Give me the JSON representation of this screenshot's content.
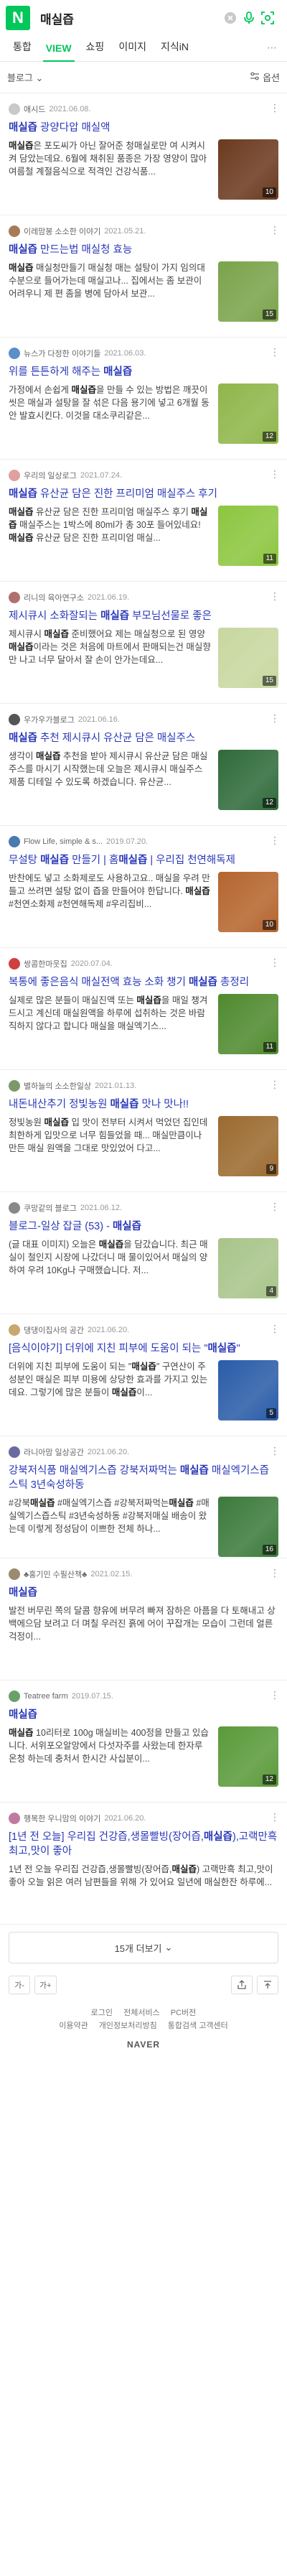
{
  "header": {
    "logo": "N",
    "query": "매실즙"
  },
  "tabs": [
    {
      "label": "통합"
    },
    {
      "label": "VIEW"
    },
    {
      "label": "쇼핑"
    },
    {
      "label": "이미지"
    },
    {
      "label": "지식iN"
    }
  ],
  "tab_more": "⋯",
  "filter": {
    "scope": "블로그",
    "option_label": "옵션"
  },
  "results": [
    {
      "author": "애시드",
      "date": "2021.06.08.",
      "title": "매실즙 광양다압 매실액",
      "desc": "매실즙은 포도씨가 아닌 잘어준 청매실로만 여 시켜시켜 담았는데요. 6월에 채취된 품종은 가장 영양이 많아 여름철 계절음식으로 적격인 건강식품...",
      "count": "10",
      "avatar": "#c9c9c9",
      "thumb": "#6b3a1f"
    },
    {
      "author": "이레맘봉 소소한 이야기",
      "date": "2021.05.21.",
      "title": "매실즙 만드는법 매실청 효능",
      "desc": "매실즙 매실청만들기 매실청 매는 설탕이 가지 임의대 수분으로 들어가는데 매실고나... 집에서는 좀 보관이 어려우니 제 편 좀을 병에 담아서 보관...",
      "count": "15",
      "avatar": "#a77a5a",
      "thumb": "#7aa34a"
    },
    {
      "author": "뉴스가 다정한 이야기들",
      "date": "2021.06.03.",
      "title": "위를 튼튼하게 해주는 매실즙",
      "desc": "가정에서 손쉽게 매실즙을 만들 수 있는 방법은 깨끗이 씻은 매실과 설탕을 잘 섞은 다음 용기에 넣고 6개월 동안 발효시킨다. 이것을 대소쿠리같은...",
      "count": "12",
      "avatar": "#5b8fc9",
      "thumb": "#8fb64a"
    },
    {
      "author": "우리의 일상로그",
      "date": "2021.07.24.",
      "title": "매실즙 유산균 담은 진한 프리미엄 매실주스 후기",
      "desc": "매실즙 유산균 담은 진한 프리미엄 매실주스 후기 매실즙 매실주스는 1박스에 80ml가 총 30포 들어있네요! 매실즙 유산균 담은 진한 프리미엄 매실...",
      "count": "11",
      "avatar": "#e0a0a0",
      "thumb": "#8cc63f"
    },
    {
      "author": "리니의 육아연구소",
      "date": "2021.06.19.",
      "title": "제시큐시 소화잘되는 매실즙 부모님선물로 좋은",
      "desc": "제시큐시 매실즙 준비했어요 제는 매실청으로 된 영양 매실즙이라는 것은 처음에 마트에서 판매되는건 매실향만 나고 너무 달아서 잘 손이 안가는데요...",
      "count": "15",
      "avatar": "#b07070",
      "thumb": "#c8d7a0"
    },
    {
      "author": "우가우가블로그",
      "date": "2021.06.16.",
      "title": "매실즙 추천 제시큐시 유산균 담은 매실주스",
      "desc": "생각이 매실즙 추천을 받아 제시큐시 유산균 담은 매실주스를 마시기 시작했는데 오늘은 제시큐시 매실주스 제품 디테일 수 있도록 하겠습니다. 유산균...",
      "count": "12",
      "avatar": "#555555",
      "thumb": "#2f6a3a"
    },
    {
      "author": "Flow Life, simple & s...",
      "date": "2019.07.20.",
      "title": "무설탕 매실즙 만들기 | 홈매실즙 | 우리집 천연해독제",
      "desc": "반찬에도 넣고 소화제로도 사용하고요.. 매실을 우려 만들고 쓰려면 설탕 없이 즙을 만들어야 한답니다. 매실즙 #천연소화제 #천연해독제 #우리집비...",
      "count": "10",
      "avatar": "#4a7ab0",
      "thumb": "#b5652e"
    },
    {
      "author": "쌍콤한마웃집",
      "date": "2020.07.04.",
      "title": "복통에 좋은음식 매실전액 효능 소화 챙기 매실즙 총정리",
      "desc": "실제로 많은 분들이 매실진액 또는 매실즙을 매일 챙겨드시고 계신데 매실원액을 하루에 섭취하는 것은 바람직하지 않다고 합니다 매실을 매실엑기스...",
      "count": "11",
      "avatar": "#d04040",
      "thumb": "#4f8a2e"
    },
    {
      "author": "별하늘의 소소한일상",
      "date": "2021.01.13.",
      "title": "내돈내산추기 정빛농원 매실즙 맛나 맛나!!",
      "desc": "정빛농원 매실즙 입 맛이 전부터 시켜서 먹었던 집인데 최한하게 입맛으로 너무 힘들었을 때... 매실만큼이나 만든 매실 원액을 그대로 맛있었어 다고...",
      "count": "9",
      "avatar": "#7a9a6a",
      "thumb": "#9b6a2f"
    },
    {
      "author": "쿠망같의 블로그",
      "date": "2021.06.12.",
      "title": "블로그-일상 잡글 (53) - 매실즙",
      "desc": "(글 대표 이미지) 오늘은 매실즙을 담갔습니다. 최근 매실이 철인지 시장에 나갔더니 매 물이있어서 매실의 양하여 우려 10Kg나 구매했습니다. 저...",
      "count": "4",
      "avatar": "#888888",
      "thumb": "#a8c48a"
    },
    {
      "author": "댕댕이집사의 공간",
      "date": "2021.06.20.",
      "title": "[음식이야기] 더위에 지친 피부에 도움이 되는 \"매실즙\"",
      "desc": "더위에 지친 피부에 도움이 되는 \"매실즙\" 구연산이 주성분인 매실은 피부 미용에 상당한 효과를 가지고 있는데요. 그렇기에 많은 분들이 매실즙이...",
      "count": "5",
      "avatar": "#c8a870",
      "thumb": "#2a5ca8"
    },
    {
      "author": "라니아맘 일상공간",
      "date": "2021.06.20.",
      "title": "강북저식품 매실엑기스즙 강북저짜먹는 매실즙 매실엑기스즙스틱 3년숙성하동",
      "desc": "#강북매실즙 #매실엑기스즙 #강북저짜먹는매실즙 #매실엑기스즙스틱 #3년숙성하동 #강북저매실 배송이 왔는데 이렇게 정성담이 이쁘한 전체 하나...",
      "count": "16",
      "avatar": "#6a6aa0",
      "thumb": "#3c7a3c"
    },
    {
      "author": "♣홍기민 수필산책♣",
      "date": "2021.02.15.",
      "title": "매실즙",
      "desc": "발전 버무린 쪽의 달콤 향유에 버무려 빠져 잠하은 아픔을 다 토해내고 상백에으담 보려고 더 며칠 우러진 흙에 어이 꾸잡개는 모습이 그런데 얼른 걱정이...",
      "count": "",
      "avatar": "#9a8a70",
      "thumb": ""
    },
    {
      "author": "Teatree farm",
      "date": "2019.07.15.",
      "title": "매실즙",
      "desc": "매실즙 10리터로 100g 매실비는 400정을 만들고 있습니다. 서위포오알앙에서 다섯자주를 사왔는데 한자루 온청 하는데 충처서 한시간 사십분이...",
      "count": "12",
      "avatar": "#6aa06a",
      "thumb": "#5a9a3a"
    },
    {
      "author": "행복한 우니맘의 이야기",
      "date": "2021.06.20.",
      "title": "[1년 전 오늘] 우리집 건강즙,생몰빨빙(장어즙,매실즙),고랙만흑 최고,맛이 좋아",
      "desc": "1년 전 오늘 우리집 건강즙,생몰빨빙(장어즙,매실즙) 고랙만흑 최고,맛이 좋아 오늘 읽은 여러 남편들을 위해 가 있어요 일년에 매실한잔 하루에...",
      "count": "",
      "avatar": "#c07aa0",
      "thumb": ""
    }
  ],
  "more_button": "15개 더보기",
  "more_icon": "chevron-down-icon",
  "toolbar": {
    "font_smaller": "가-",
    "font_larger": "가+"
  },
  "footer": {
    "links_row1": [
      "로그인",
      "전체서비스",
      "PC버전"
    ],
    "links_row2": [
      "이용약관",
      "개인정보처리방침",
      "통합검색 고객센터"
    ],
    "brand": "NAVER"
  }
}
